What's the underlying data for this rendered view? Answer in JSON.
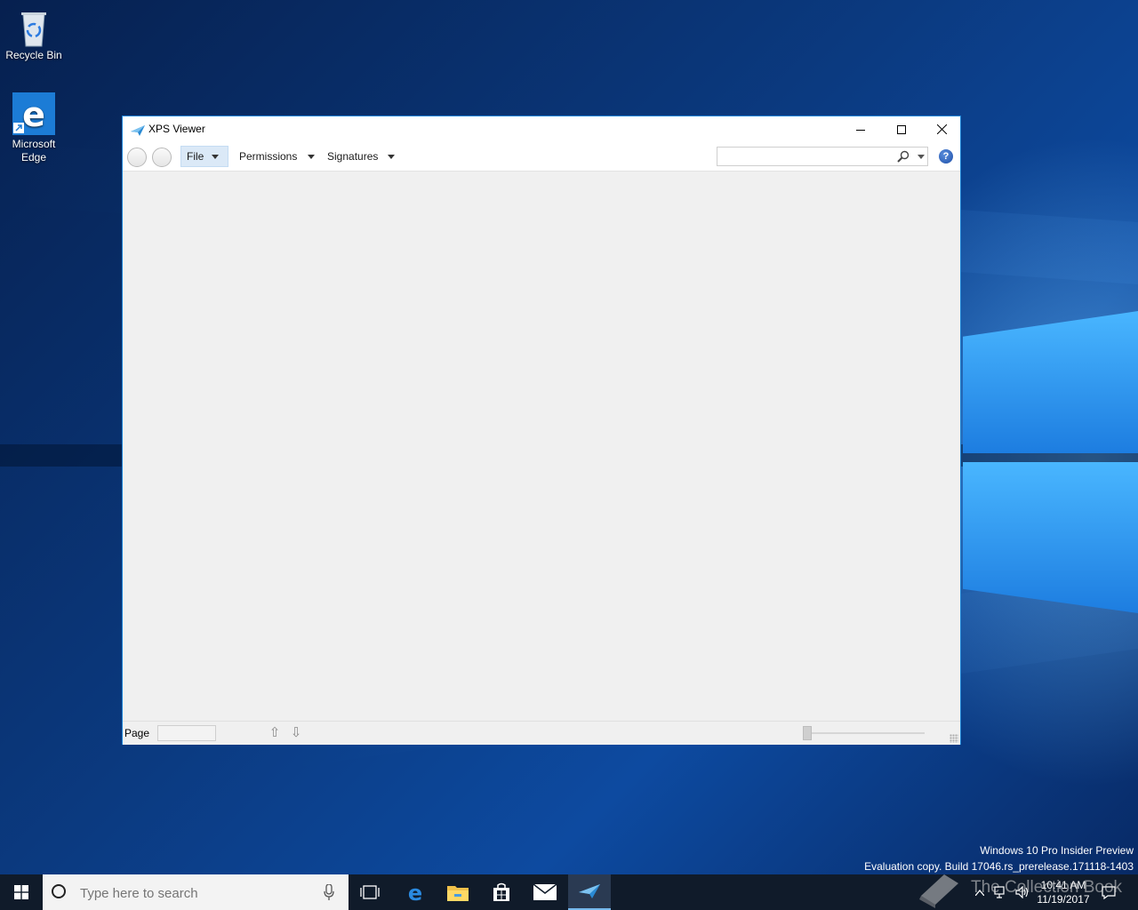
{
  "desktop": {
    "icons": [
      {
        "label": "Recycle Bin",
        "icon": "recycle-bin-icon"
      },
      {
        "label": "Microsoft Edge",
        "icon": "edge-icon"
      }
    ],
    "watermark": {
      "line1": "Windows 10 Pro Insider Preview",
      "line2": "Evaluation copy. Build 17046.rs_prerelease.171118-1403"
    },
    "overlay_watermark": "The Collection Book"
  },
  "window": {
    "title": "XPS Viewer",
    "controls": {
      "minimize": "minimize-icon",
      "maximize": "maximize-icon",
      "close": "close-icon"
    },
    "toolbar": {
      "menus": [
        {
          "label": "File",
          "active": true
        },
        {
          "label": "Permissions",
          "active": false
        },
        {
          "label": "Signatures",
          "active": false
        }
      ],
      "search": {
        "value": "",
        "placeholder": ""
      },
      "help_label": "?"
    },
    "status": {
      "page_label": "Page",
      "page_value": "",
      "up_arrow": "⇧",
      "down_arrow": "⇩"
    }
  },
  "taskbar": {
    "search_placeholder": "Type here to search",
    "apps": [
      "task-view-icon",
      "edge-icon",
      "file-explorer-icon",
      "store-icon",
      "mail-icon",
      "xps-viewer-icon"
    ],
    "clock": {
      "time": "10:41 AM",
      "date": "11/19/2017"
    }
  }
}
